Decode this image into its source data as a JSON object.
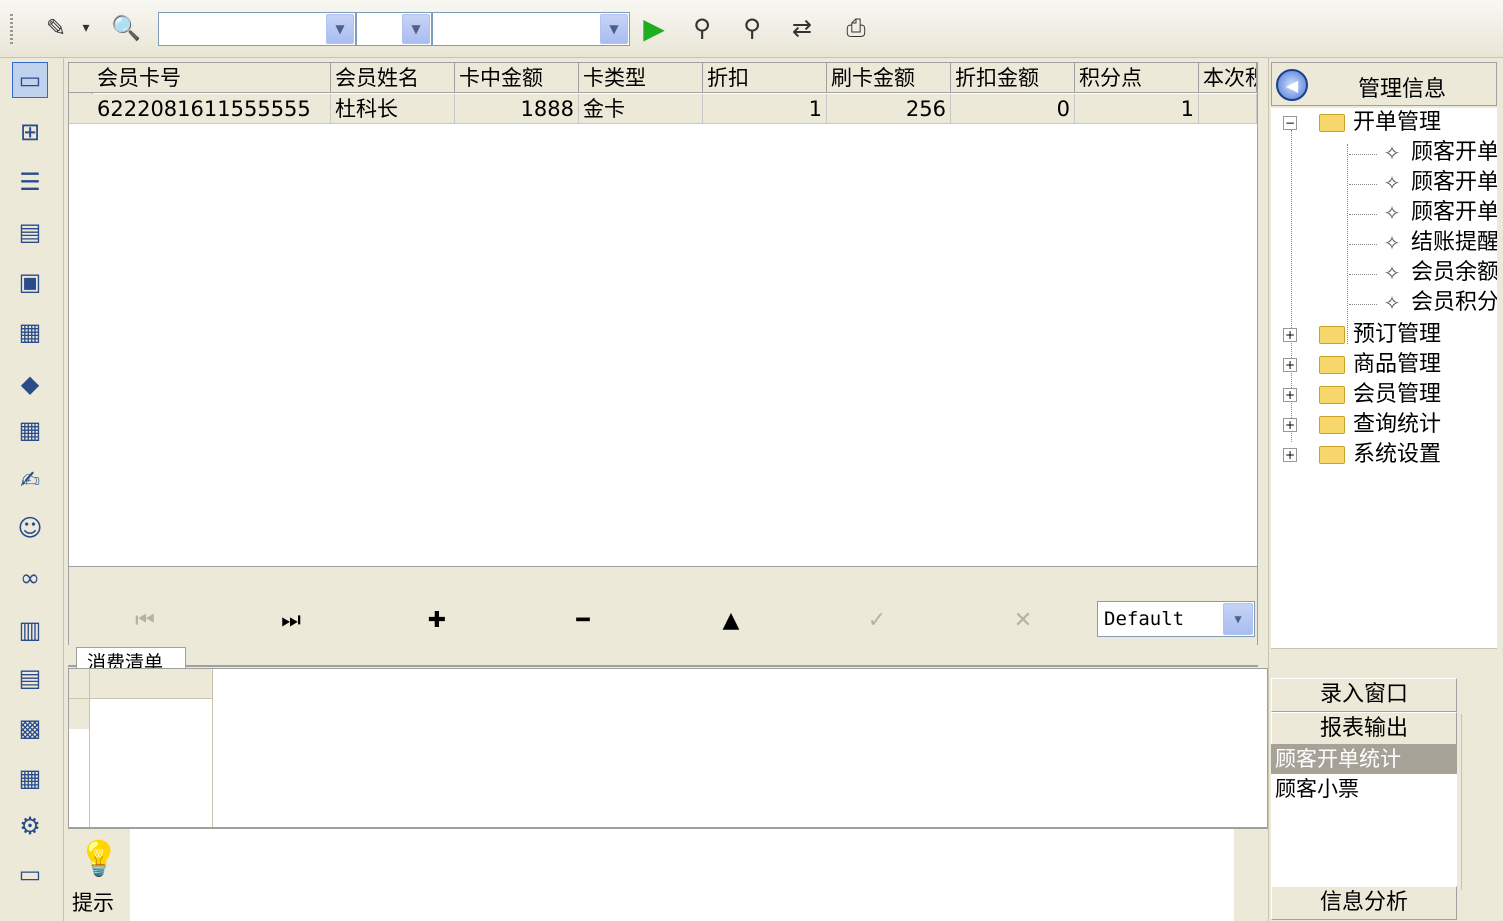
{
  "toolbar": {
    "icons": [
      "pencil-icon",
      "dropdown-arrow-icon",
      "search-doc-icon",
      "play-icon",
      "find-icon",
      "find-next-icon",
      "replace-icon",
      "print-icon"
    ],
    "combo1_value": "",
    "combo2_value": "",
    "combo3_value": ""
  },
  "sidebar": {
    "icons": [
      "window-icon",
      "tree-icon",
      "list-icon",
      "document-icon",
      "chart-icon",
      "calendar-icon",
      "diamond-grid-icon",
      "table-icon",
      "edit-icon",
      "users-icon",
      "binoculars-icon",
      "card-icon",
      "report-icon",
      "calc-icon",
      "grid-icon",
      "settings-icon",
      "note-icon"
    ]
  },
  "grid": {
    "headers": [
      "会员卡号",
      "会员姓名",
      "卡中金额",
      "卡类型",
      "折扣",
      "刷卡金额",
      "折扣金额",
      "积分点",
      "本次积"
    ],
    "rows": [
      [
        "6222081611555555",
        "杜科长",
        "1888",
        "金卡",
        "1",
        "256",
        "0",
        "1",
        ""
      ]
    ]
  },
  "navigator": {
    "layout_value": "Default"
  },
  "tabs": {
    "bottom_tab": "消费清单"
  },
  "hint": {
    "label": "提示"
  },
  "rpanel": {
    "title": "管理信息",
    "tree": {
      "root": "开单管理",
      "leaves": [
        "顾客开单",
        "顾客开单",
        "顾客开单",
        "结账提醒",
        "会员余额",
        "会员积分"
      ],
      "folders": [
        "预订管理",
        "商品管理",
        "会员管理",
        "查询统计",
        "系统设置"
      ]
    },
    "btn_input": "录入窗口",
    "btn_report": "报表输出",
    "report_items": [
      "顾客开单统计",
      "顾客小票"
    ],
    "btn_analysis": "信息分析"
  }
}
